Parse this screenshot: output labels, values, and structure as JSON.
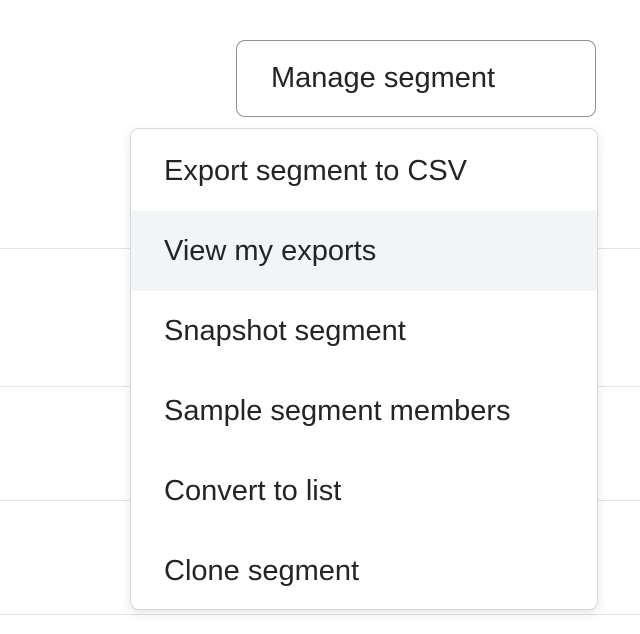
{
  "manage_button": {
    "label": "Manage segment"
  },
  "menu": {
    "items": [
      {
        "label": "Export segment to CSV"
      },
      {
        "label": "View my exports"
      },
      {
        "label": "Snapshot segment"
      },
      {
        "label": "Sample segment members"
      },
      {
        "label": "Convert to list"
      },
      {
        "label": "Clone segment"
      }
    ]
  },
  "colors": {
    "text": "#232426",
    "button_border": "#8f9194",
    "menu_border": "#d5d8db",
    "hover_background": "#f1f5f6",
    "divider": "#e3e6e8"
  }
}
